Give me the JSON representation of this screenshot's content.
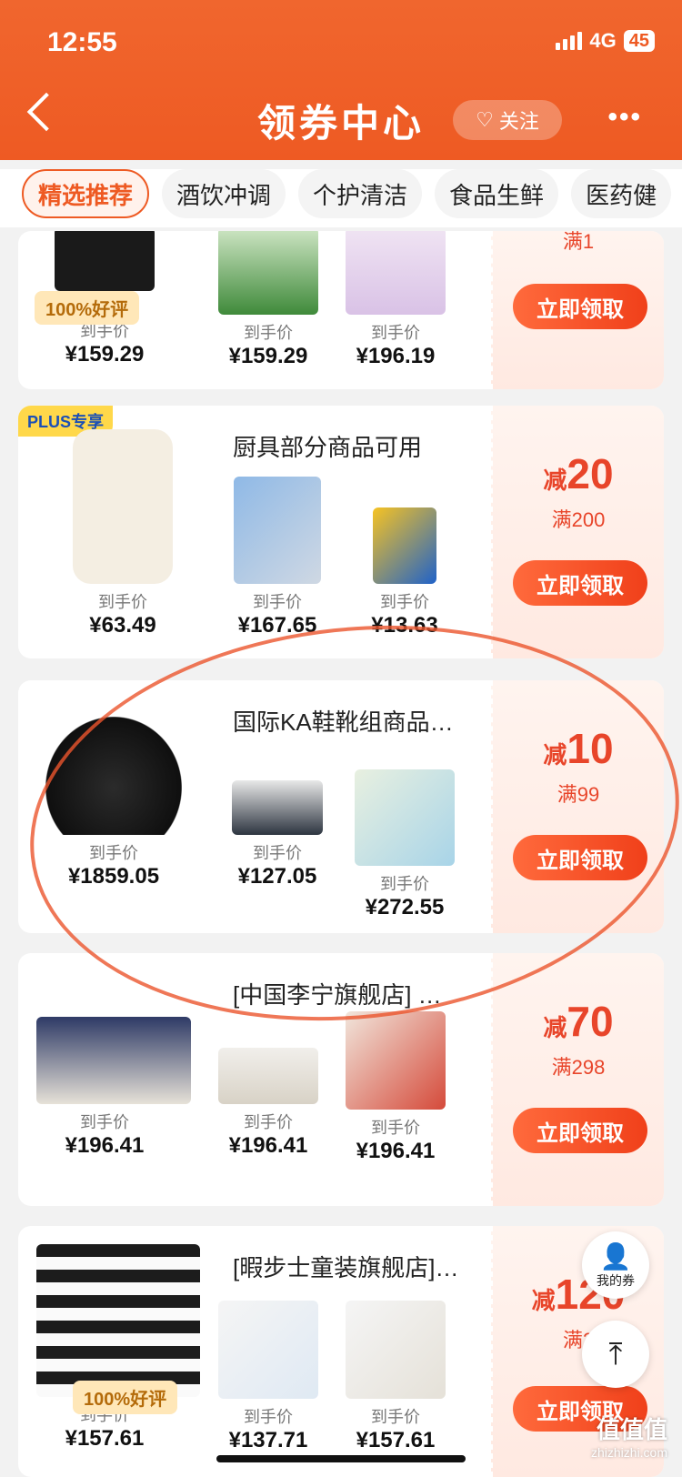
{
  "status_bar": {
    "time": "12:55",
    "network": "4G",
    "battery": "45"
  },
  "header": {
    "title": "领券中心",
    "follow_label": "关注",
    "more": "•••"
  },
  "tabs": [
    "精选推荐",
    "酒饮冲调",
    "个护清洁",
    "食品生鲜",
    "医药健"
  ],
  "cards": [
    {
      "shop": "",
      "good_review": "100%好评",
      "products": [
        {
          "price_label": "到手价",
          "price": "¥159.29"
        },
        {
          "price_label": "到手价",
          "price": "¥159.29"
        },
        {
          "price_label": "到手价",
          "price": "¥196.19"
        }
      ],
      "coupon": {
        "cond": "满1",
        "claim": "立即领取"
      }
    },
    {
      "tag": "PLUS专享",
      "shop": "厨具部分商品可用",
      "products": [
        {
          "price_label": "到手价",
          "price": "¥63.49"
        },
        {
          "price_label": "到手价",
          "price": "¥167.65"
        },
        {
          "price_label": "到手价",
          "price": "¥13.63"
        }
      ],
      "coupon": {
        "prefix": "减",
        "amount": "20",
        "cond": "满200",
        "claim": "立即领取"
      }
    },
    {
      "shop": "国际KA鞋靴组商品…",
      "products": [
        {
          "price_label": "到手价",
          "price": "¥1859.05"
        },
        {
          "price_label": "到手价",
          "price": "¥127.05"
        },
        {
          "price_label": "到手价",
          "price": "¥272.55"
        }
      ],
      "coupon": {
        "prefix": "减",
        "amount": "10",
        "cond": "满99",
        "claim": "立即领取"
      }
    },
    {
      "shop": "[中国李宁旗舰店] …",
      "products": [
        {
          "price_label": "到手价",
          "price": "¥196.41"
        },
        {
          "price_label": "到手价",
          "price": "¥196.41"
        },
        {
          "price_label": "到手价",
          "price": "¥196.41"
        }
      ],
      "coupon": {
        "prefix": "减",
        "amount": "70",
        "cond": "满298",
        "claim": "立即领取"
      }
    },
    {
      "shop": "[暇步士童装旗舰店]…",
      "good_review": "100%好评",
      "products": [
        {
          "price_label": "到手价",
          "price": "¥157.61"
        },
        {
          "price_label": "到手价",
          "price": "¥137.71"
        },
        {
          "price_label": "到手价",
          "price": "¥157.61"
        }
      ],
      "coupon": {
        "prefix": "减",
        "amount": "120",
        "cond": "满2",
        "claim": "立即领取"
      }
    }
  ],
  "floating": {
    "my_coupons": "我的券"
  },
  "watermark": {
    "main": "值值值",
    "sub": "zhizhizhi.com"
  },
  "colors": {
    "brand": "#ee5a23",
    "accent": "#e8452a"
  }
}
